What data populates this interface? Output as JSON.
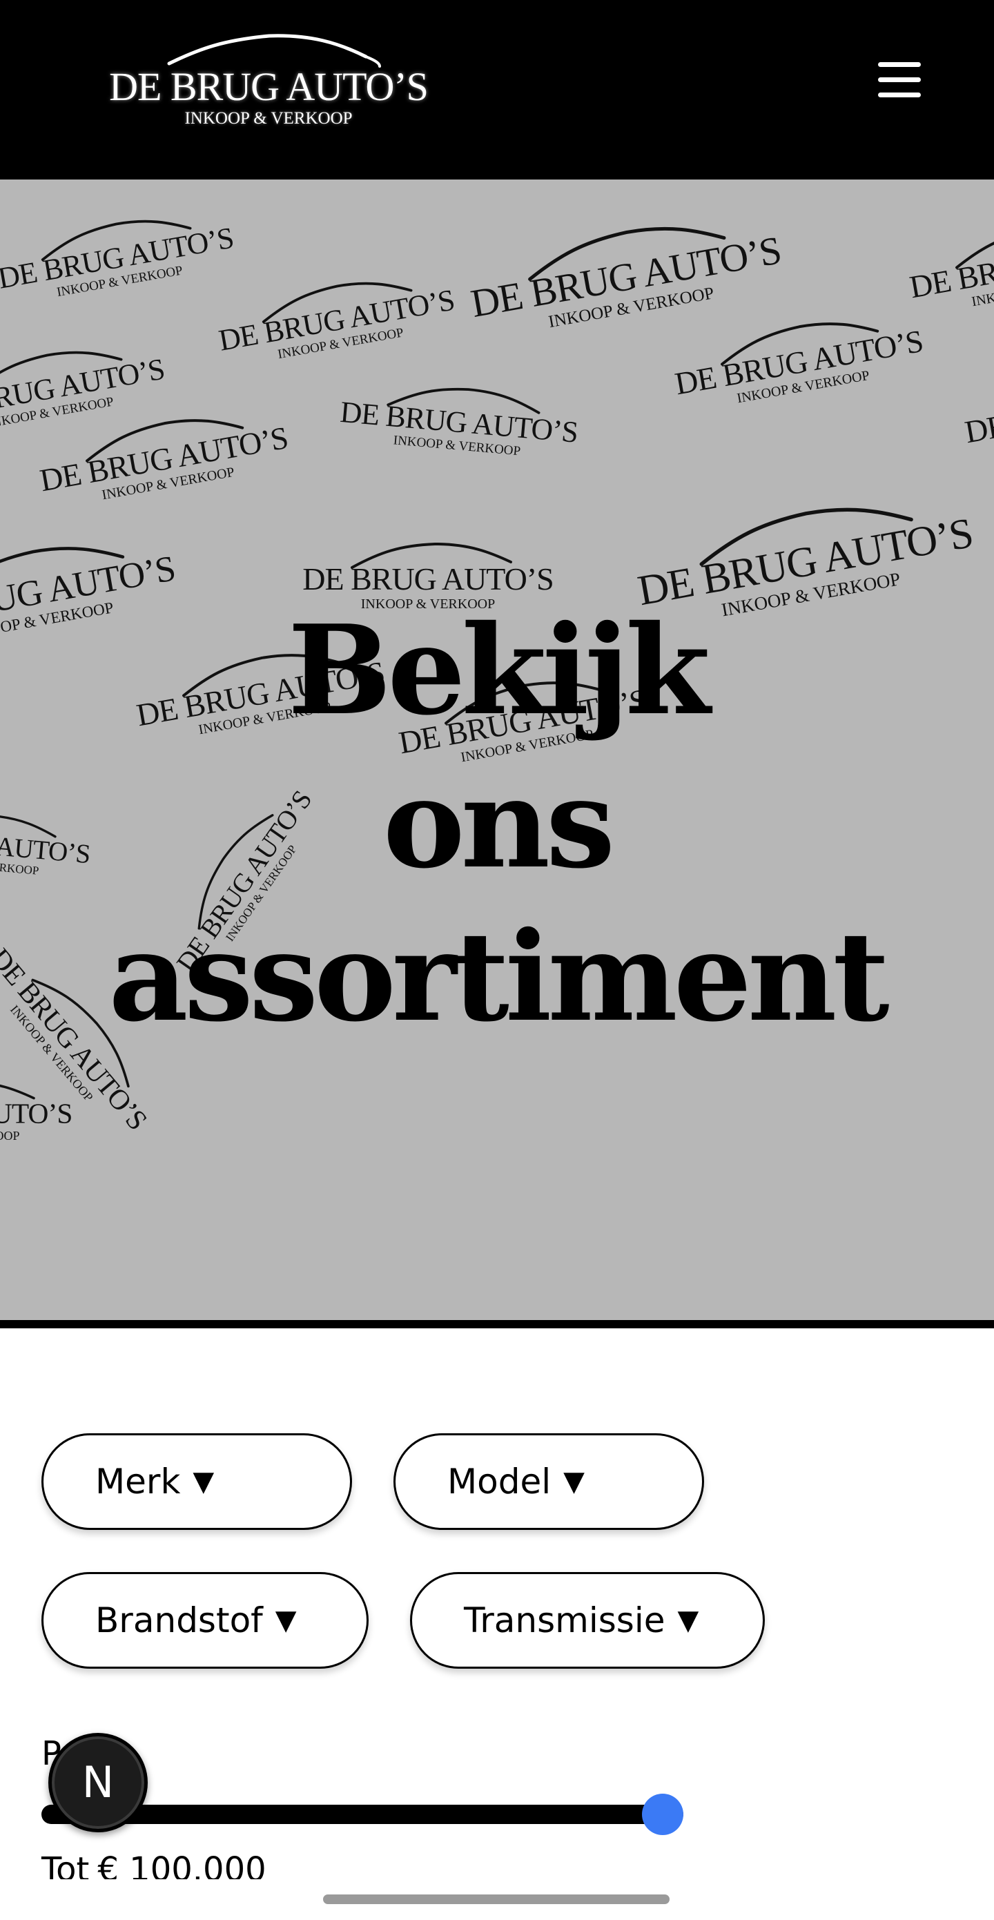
{
  "header": {
    "logo": {
      "main": "DE BRUG AUTO’S",
      "sub": "INKOOP & VERKOOP"
    },
    "menu_icon": "hamburger-menu-icon"
  },
  "hero": {
    "title_lines": [
      "Bekijk",
      "ons",
      "assortiment"
    ],
    "watermark": {
      "main": "DE BRUG AUTO’S",
      "sub": "INKOOP & VERKOOP"
    }
  },
  "filters": [
    {
      "label": "Merk"
    },
    {
      "label": "Model"
    },
    {
      "label": "Brandstof"
    },
    {
      "label": "Transmissie"
    }
  ],
  "filter_caret": "▼",
  "price": {
    "label": "Prijs",
    "value_prefix": "Tot",
    "currency": "€",
    "max_value": "100.000",
    "slider_fraction": 1.0,
    "accent_color": "#3b7af5"
  },
  "overlay": {
    "badge_letter": "N"
  },
  "colors": {
    "header_bg": "#000000",
    "hero_bg": "#b7b7b7",
    "slider_thumb": "#3b7af5"
  }
}
